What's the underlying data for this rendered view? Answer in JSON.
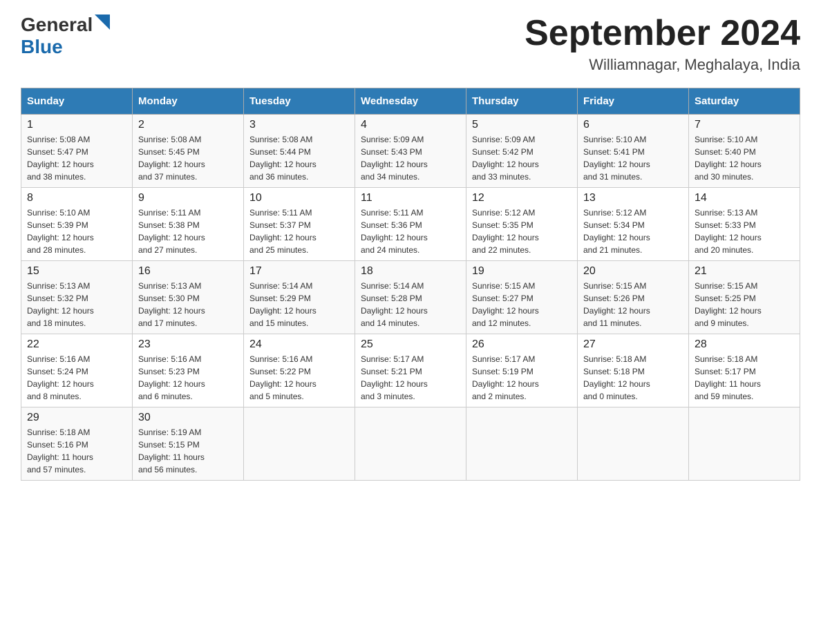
{
  "logo": {
    "general": "General",
    "blue": "Blue"
  },
  "title": "September 2024",
  "subtitle": "Williamnagar, Meghalaya, India",
  "days_of_week": [
    "Sunday",
    "Monday",
    "Tuesday",
    "Wednesday",
    "Thursday",
    "Friday",
    "Saturday"
  ],
  "weeks": [
    [
      {
        "day": "1",
        "sunrise": "5:08 AM",
        "sunset": "5:47 PM",
        "daylight": "12 hours and 38 minutes."
      },
      {
        "day": "2",
        "sunrise": "5:08 AM",
        "sunset": "5:45 PM",
        "daylight": "12 hours and 37 minutes."
      },
      {
        "day": "3",
        "sunrise": "5:08 AM",
        "sunset": "5:44 PM",
        "daylight": "12 hours and 36 minutes."
      },
      {
        "day": "4",
        "sunrise": "5:09 AM",
        "sunset": "5:43 PM",
        "daylight": "12 hours and 34 minutes."
      },
      {
        "day": "5",
        "sunrise": "5:09 AM",
        "sunset": "5:42 PM",
        "daylight": "12 hours and 33 minutes."
      },
      {
        "day": "6",
        "sunrise": "5:10 AM",
        "sunset": "5:41 PM",
        "daylight": "12 hours and 31 minutes."
      },
      {
        "day": "7",
        "sunrise": "5:10 AM",
        "sunset": "5:40 PM",
        "daylight": "12 hours and 30 minutes."
      }
    ],
    [
      {
        "day": "8",
        "sunrise": "5:10 AM",
        "sunset": "5:39 PM",
        "daylight": "12 hours and 28 minutes."
      },
      {
        "day": "9",
        "sunrise": "5:11 AM",
        "sunset": "5:38 PM",
        "daylight": "12 hours and 27 minutes."
      },
      {
        "day": "10",
        "sunrise": "5:11 AM",
        "sunset": "5:37 PM",
        "daylight": "12 hours and 25 minutes."
      },
      {
        "day": "11",
        "sunrise": "5:11 AM",
        "sunset": "5:36 PM",
        "daylight": "12 hours and 24 minutes."
      },
      {
        "day": "12",
        "sunrise": "5:12 AM",
        "sunset": "5:35 PM",
        "daylight": "12 hours and 22 minutes."
      },
      {
        "day": "13",
        "sunrise": "5:12 AM",
        "sunset": "5:34 PM",
        "daylight": "12 hours and 21 minutes."
      },
      {
        "day": "14",
        "sunrise": "5:13 AM",
        "sunset": "5:33 PM",
        "daylight": "12 hours and 20 minutes."
      }
    ],
    [
      {
        "day": "15",
        "sunrise": "5:13 AM",
        "sunset": "5:32 PM",
        "daylight": "12 hours and 18 minutes."
      },
      {
        "day": "16",
        "sunrise": "5:13 AM",
        "sunset": "5:30 PM",
        "daylight": "12 hours and 17 minutes."
      },
      {
        "day": "17",
        "sunrise": "5:14 AM",
        "sunset": "5:29 PM",
        "daylight": "12 hours and 15 minutes."
      },
      {
        "day": "18",
        "sunrise": "5:14 AM",
        "sunset": "5:28 PM",
        "daylight": "12 hours and 14 minutes."
      },
      {
        "day": "19",
        "sunrise": "5:15 AM",
        "sunset": "5:27 PM",
        "daylight": "12 hours and 12 minutes."
      },
      {
        "day": "20",
        "sunrise": "5:15 AM",
        "sunset": "5:26 PM",
        "daylight": "12 hours and 11 minutes."
      },
      {
        "day": "21",
        "sunrise": "5:15 AM",
        "sunset": "5:25 PM",
        "daylight": "12 hours and 9 minutes."
      }
    ],
    [
      {
        "day": "22",
        "sunrise": "5:16 AM",
        "sunset": "5:24 PM",
        "daylight": "12 hours and 8 minutes."
      },
      {
        "day": "23",
        "sunrise": "5:16 AM",
        "sunset": "5:23 PM",
        "daylight": "12 hours and 6 minutes."
      },
      {
        "day": "24",
        "sunrise": "5:16 AM",
        "sunset": "5:22 PM",
        "daylight": "12 hours and 5 minutes."
      },
      {
        "day": "25",
        "sunrise": "5:17 AM",
        "sunset": "5:21 PM",
        "daylight": "12 hours and 3 minutes."
      },
      {
        "day": "26",
        "sunrise": "5:17 AM",
        "sunset": "5:19 PM",
        "daylight": "12 hours and 2 minutes."
      },
      {
        "day": "27",
        "sunrise": "5:18 AM",
        "sunset": "5:18 PM",
        "daylight": "12 hours and 0 minutes."
      },
      {
        "day": "28",
        "sunrise": "5:18 AM",
        "sunset": "5:17 PM",
        "daylight": "11 hours and 59 minutes."
      }
    ],
    [
      {
        "day": "29",
        "sunrise": "5:18 AM",
        "sunset": "5:16 PM",
        "daylight": "11 hours and 57 minutes."
      },
      {
        "day": "30",
        "sunrise": "5:19 AM",
        "sunset": "5:15 PM",
        "daylight": "11 hours and 56 minutes."
      },
      null,
      null,
      null,
      null,
      null
    ]
  ],
  "labels": {
    "sunrise": "Sunrise:",
    "sunset": "Sunset:",
    "daylight": "Daylight:"
  }
}
